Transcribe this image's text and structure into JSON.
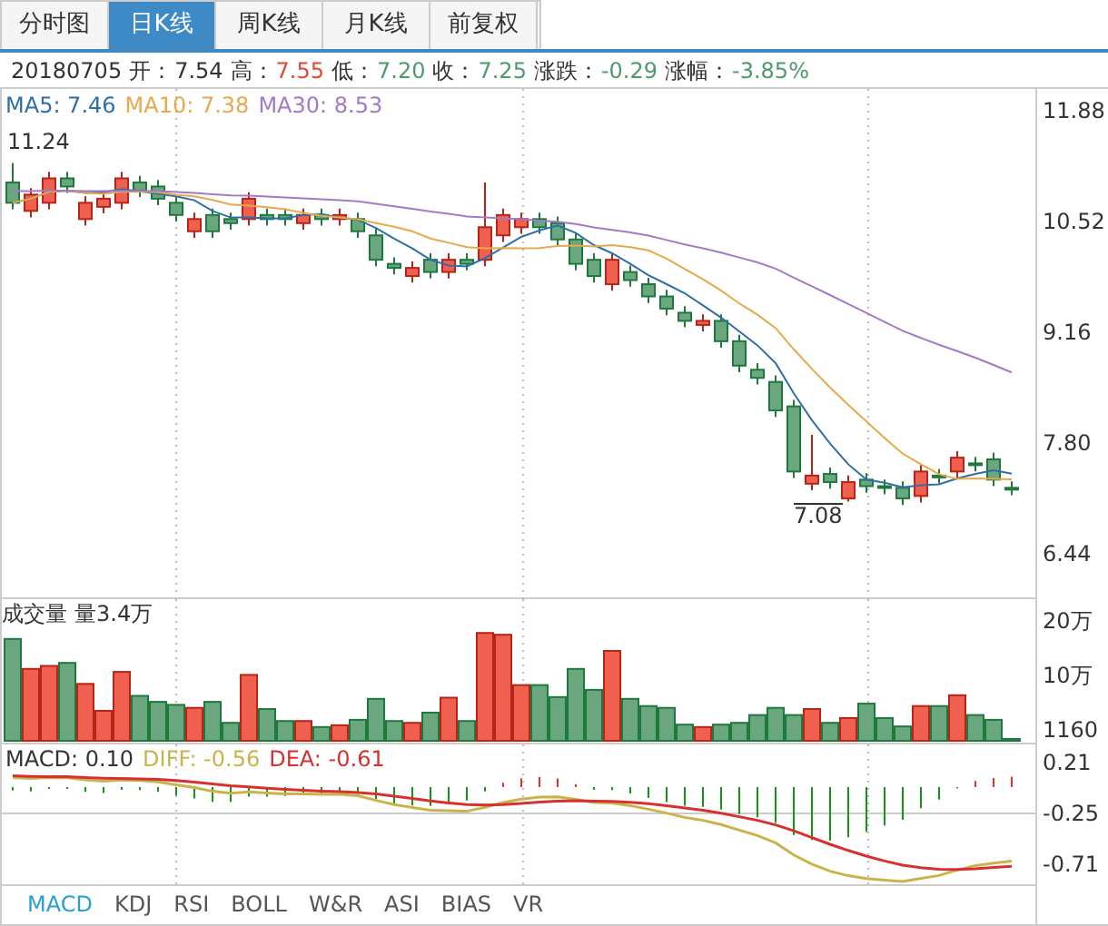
{
  "tabs": [
    {
      "label": "分时图",
      "selected": false
    },
    {
      "label": "日K线",
      "selected": true
    },
    {
      "label": "周K线",
      "selected": false
    },
    {
      "label": "月K线",
      "selected": false
    },
    {
      "label": "前复权",
      "selected": false
    }
  ],
  "quote": {
    "date": "20180705",
    "fields": [
      {
        "label": "开：",
        "value": "7.54",
        "color": "#333333"
      },
      {
        "label": "高：",
        "value": "7.55",
        "color": "#e0463a"
      },
      {
        "label": "低：",
        "value": "7.20",
        "color": "#4f9a6c"
      },
      {
        "label": "收：",
        "value": "7.25",
        "color": "#4f9a6c"
      },
      {
        "label": "涨跌：",
        "value": "-0.29",
        "color": "#4f9a6c"
      },
      {
        "label": "涨幅：",
        "value": "-3.85%",
        "color": "#4f9a6c"
      }
    ]
  },
  "price_panel": {
    "legend": [
      {
        "text": "MA5: 7.46",
        "color": "#2f6fa8"
      },
      {
        "text": "MA10: 7.38",
        "color": "#e8a84c"
      },
      {
        "text": "MA30: 8.53",
        "color": "#a27bc4"
      }
    ],
    "high_label": "11.24",
    "low_label": "7.08",
    "axis": [
      "11.88",
      "10.52",
      "9.16",
      "7.80",
      "6.44"
    ]
  },
  "volume_panel": {
    "title": "成交量",
    "volume": "量3.4万",
    "axis": [
      "20万",
      "10万",
      "1160"
    ]
  },
  "macd_panel": {
    "legend": [
      {
        "text": "MACD: 0.10",
        "color": "#333333"
      },
      {
        "text": "DIFF: -0.56",
        "color": "#c8b44a"
      },
      {
        "text": "DEA: -0.61",
        "color": "#d83030"
      }
    ],
    "axis": [
      "0.21",
      "-0.25",
      "-0.71"
    ]
  },
  "indicator_tabs": [
    {
      "label": "MACD",
      "selected": true
    },
    {
      "label": "KDJ",
      "selected": false
    },
    {
      "label": "RSI",
      "selected": false
    },
    {
      "label": "BOLL",
      "selected": false
    },
    {
      "label": "W&R",
      "selected": false
    },
    {
      "label": "ASI",
      "selected": false
    },
    {
      "label": "BIAS",
      "selected": false
    },
    {
      "label": "VR",
      "selected": false
    }
  ]
}
